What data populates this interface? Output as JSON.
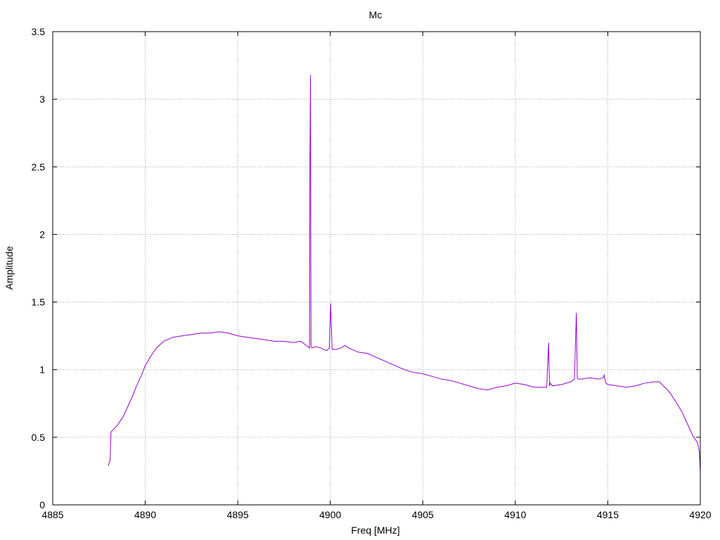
{
  "chart_data": {
    "type": "line",
    "title": "Mc",
    "xlabel": "Freq [MHz]",
    "ylabel": "Amplitude",
    "xlim": [
      4885,
      4920
    ],
    "ylim": [
      0,
      3.5
    ],
    "xticks": [
      4885,
      4890,
      4895,
      4900,
      4905,
      4910,
      4915,
      4920
    ],
    "yticks": [
      0,
      0.5,
      1,
      1.5,
      2,
      2.5,
      3,
      3.5
    ],
    "xtick_labels": [
      "4885",
      "4890",
      "4895",
      "4900",
      "4905",
      "4910",
      "4915",
      "4920"
    ],
    "ytick_labels": [
      "0",
      "0.5",
      "1",
      "1.5",
      "2",
      "2.5",
      "3",
      "3.5"
    ],
    "grid": true,
    "line_color": "#9400d3",
    "series": [
      {
        "x": [
          4888.0,
          4888.1,
          4888.15,
          4888.3,
          4888.5,
          4888.8,
          4889.0,
          4889.3,
          4889.5,
          4889.8,
          4890.0,
          4890.3,
          4890.6,
          4891.0,
          4891.5,
          4892.0,
          4892.5,
          4893.0,
          4893.5,
          4894.0,
          4894.5,
          4895.0,
          4895.5,
          4896.0,
          4896.5,
          4897.0,
          4897.5,
          4898.0,
          4898.4,
          4898.7,
          4898.88,
          4898.9,
          4898.93,
          4898.96,
          4899.0,
          4899.2,
          4899.5,
          4899.8,
          4899.95,
          4900.02,
          4900.1,
          4900.3,
          4900.6,
          4900.8,
          4901.0,
          4901.5,
          4902.0,
          4902.5,
          4903.0,
          4903.5,
          4904.0,
          4904.5,
          4905.0,
          4905.5,
          4906.0,
          4906.5,
          4907.0,
          4907.5,
          4908.0,
          4908.5,
          4909.0,
          4909.5,
          4910.0,
          4910.5,
          4911.0,
          4911.5,
          4911.7,
          4911.8,
          4911.85,
          4911.9,
          4912.0,
          4912.5,
          4913.0,
          4913.2,
          4913.3,
          4913.35,
          4913.4,
          4913.6,
          4914.0,
          4914.5,
          4914.75,
          4914.8,
          4914.9,
          4915.0,
          4915.5,
          4916.0,
          4916.5,
          4917.0,
          4917.5,
          4917.8,
          4918.0,
          4918.3,
          4918.6,
          4919.0,
          4919.3,
          4919.6,
          4919.85,
          4919.95,
          4920.0
        ],
        "y": [
          0.29,
          0.33,
          0.54,
          0.56,
          0.59,
          0.65,
          0.71,
          0.8,
          0.87,
          0.96,
          1.03,
          1.1,
          1.16,
          1.21,
          1.24,
          1.25,
          1.26,
          1.27,
          1.27,
          1.28,
          1.27,
          1.25,
          1.24,
          1.23,
          1.22,
          1.21,
          1.21,
          1.2,
          1.21,
          1.18,
          1.16,
          2.53,
          3.18,
          1.18,
          1.16,
          1.17,
          1.16,
          1.14,
          1.16,
          1.49,
          1.15,
          1.15,
          1.16,
          1.18,
          1.16,
          1.13,
          1.12,
          1.09,
          1.06,
          1.03,
          1.0,
          0.98,
          0.97,
          0.95,
          0.93,
          0.92,
          0.9,
          0.88,
          0.86,
          0.85,
          0.87,
          0.88,
          0.9,
          0.89,
          0.87,
          0.87,
          0.87,
          1.2,
          0.88,
          0.9,
          0.88,
          0.89,
          0.91,
          0.93,
          1.42,
          0.94,
          0.93,
          0.93,
          0.94,
          0.93,
          0.94,
          0.96,
          0.9,
          0.89,
          0.88,
          0.87,
          0.88,
          0.9,
          0.91,
          0.91,
          0.88,
          0.84,
          0.78,
          0.69,
          0.6,
          0.51,
          0.46,
          0.39,
          0.24
        ]
      }
    ]
  }
}
